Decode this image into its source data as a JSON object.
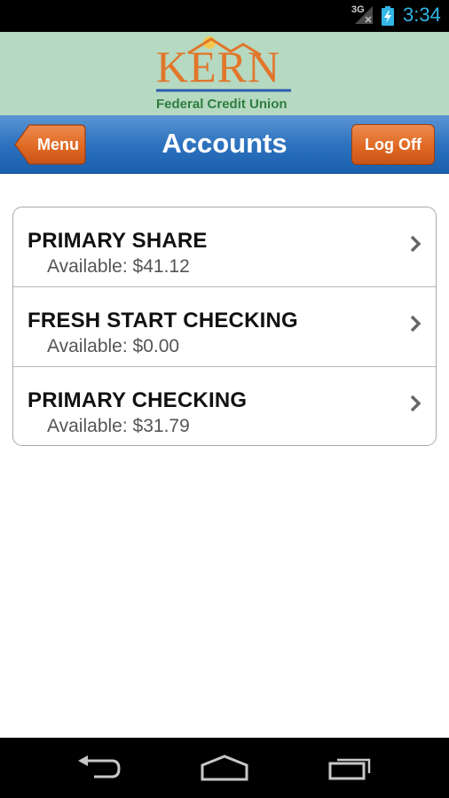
{
  "status_bar": {
    "network": "3G",
    "time": "3:34",
    "accent_color": "#33b5e5"
  },
  "brand": {
    "logo_name": "KERN",
    "logo_subtitle": "Federal Credit Union",
    "background_color": "#b6d9c1",
    "logo_orange": "#e1762b",
    "logo_green": "#2f7d3f"
  },
  "navbar": {
    "title": "Accounts",
    "menu_label": "Menu",
    "logoff_label": "Log Off",
    "bar_color": "#2e73bf",
    "button_color": "#e06a23"
  },
  "accounts": [
    {
      "name": "PRIMARY SHARE",
      "available_label": "Available:",
      "available": "$41.12"
    },
    {
      "name": "FRESH START CHECKING",
      "available_label": "Available:",
      "available": "$0.00"
    },
    {
      "name": "PRIMARY CHECKING",
      "available_label": "Available:",
      "available": "$31.79"
    }
  ],
  "icons": {
    "signal": "signal-icon",
    "battery": "battery-charging-icon",
    "chevron": "chevron-right-icon",
    "back": "back-icon",
    "home": "home-icon",
    "recents": "recent-apps-icon"
  }
}
